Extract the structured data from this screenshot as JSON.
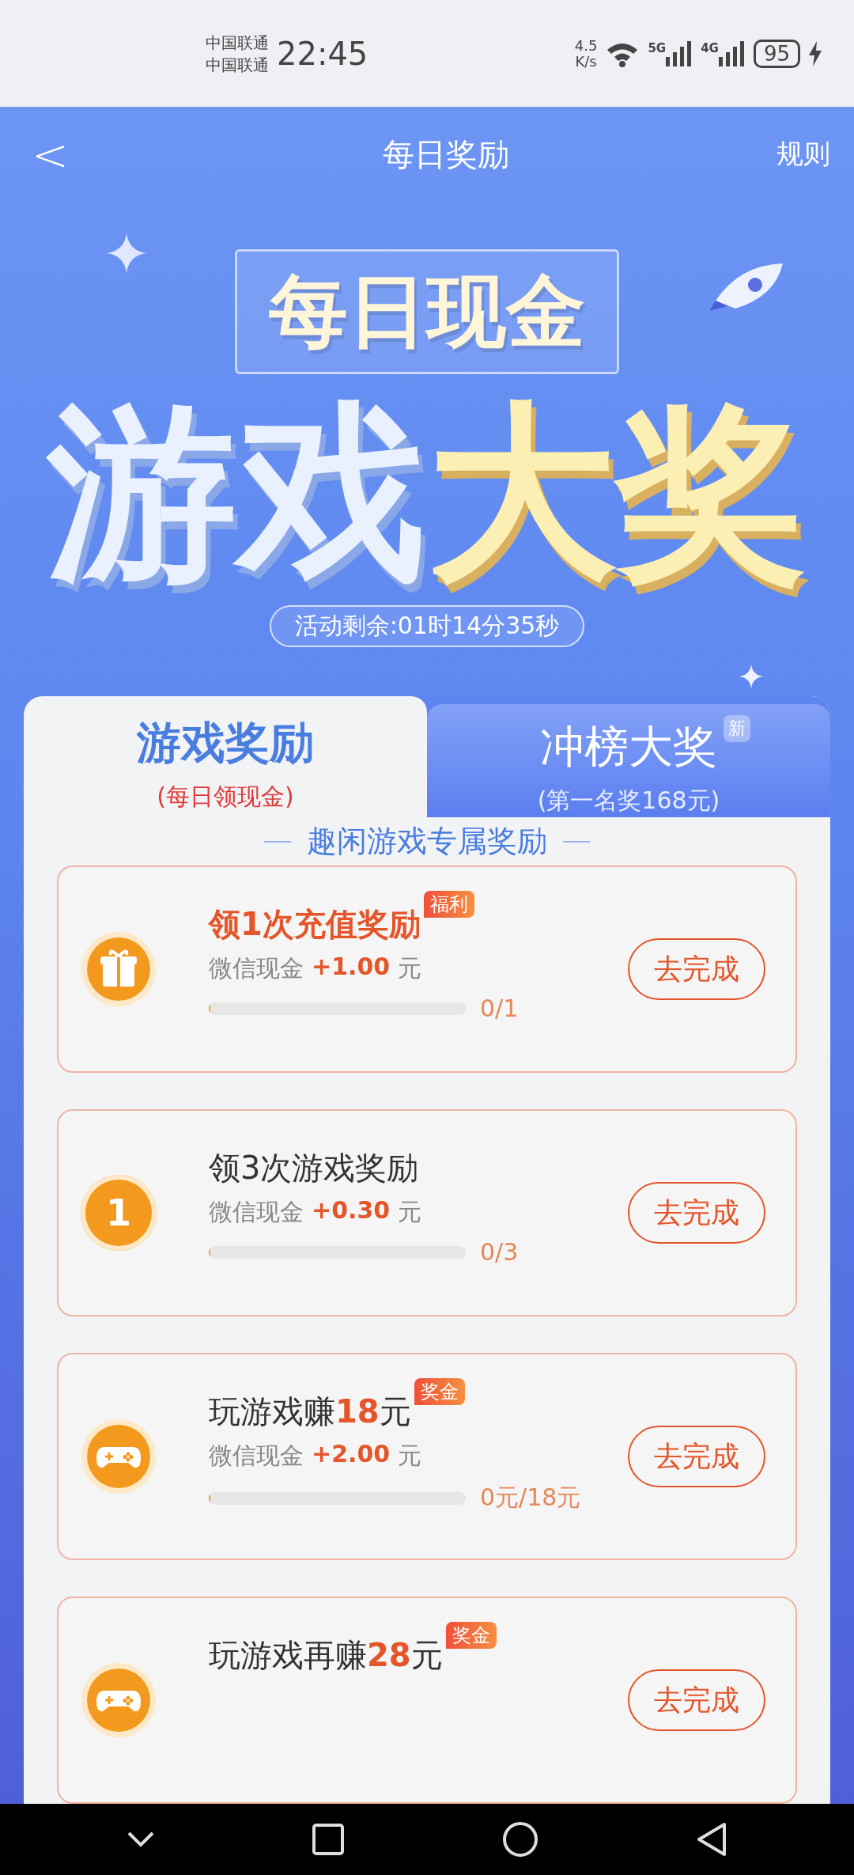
{
  "status_bar": {
    "carriers": [
      "中国联通",
      "中国联通"
    ],
    "time": "22:45",
    "speed_value": "4.5",
    "speed_unit": "K/s",
    "signals": [
      "5G",
      "4G"
    ],
    "battery": "95"
  },
  "nav": {
    "back": "<",
    "title": "每日奖励",
    "rules": "规则"
  },
  "banner": {
    "subtitle": "每日现金",
    "title_main": "游戏",
    "title_accent": "大奖",
    "countdown": "活动剩余:01时14分35秒"
  },
  "tabs": [
    {
      "label": "游戏奖励",
      "sub": "(每日领现金)",
      "selected": true
    },
    {
      "label": "冲榜大奖",
      "sub": "(第一名奖168元)",
      "selected": false,
      "badge": "新"
    }
  ],
  "section_title": "趣闲游戏专属奖励",
  "tasks": [
    {
      "kind": "gift",
      "title": "领1次充值奖励",
      "emphasized": true,
      "badge": "福利",
      "reward_label": "微信现金",
      "reward": "+1.00",
      "unit": "元",
      "level": 0,
      "progress": "0/1",
      "button": "去完成"
    },
    {
      "kind": "number",
      "icon_text": "1",
      "title": "领3次游戏奖励",
      "emphasized": false,
      "reward_label": "微信现金",
      "reward": "+0.30",
      "unit": "元",
      "level": 0,
      "progress": "0/3",
      "button": "去完成"
    },
    {
      "kind": "gamepad",
      "title": "玩游戏赚**18**元",
      "emphasized": false,
      "badge": "奖金",
      "reward_label": "微信现金",
      "reward": "+2.00",
      "unit": "元",
      "level": 0,
      "progress": "0元/18元",
      "button": "去完成"
    },
    {
      "kind": "gamepad",
      "title": "玩游戏再赚**28**元",
      "emphasized": false,
      "badge": "奖金",
      "button": "去完成"
    }
  ]
}
